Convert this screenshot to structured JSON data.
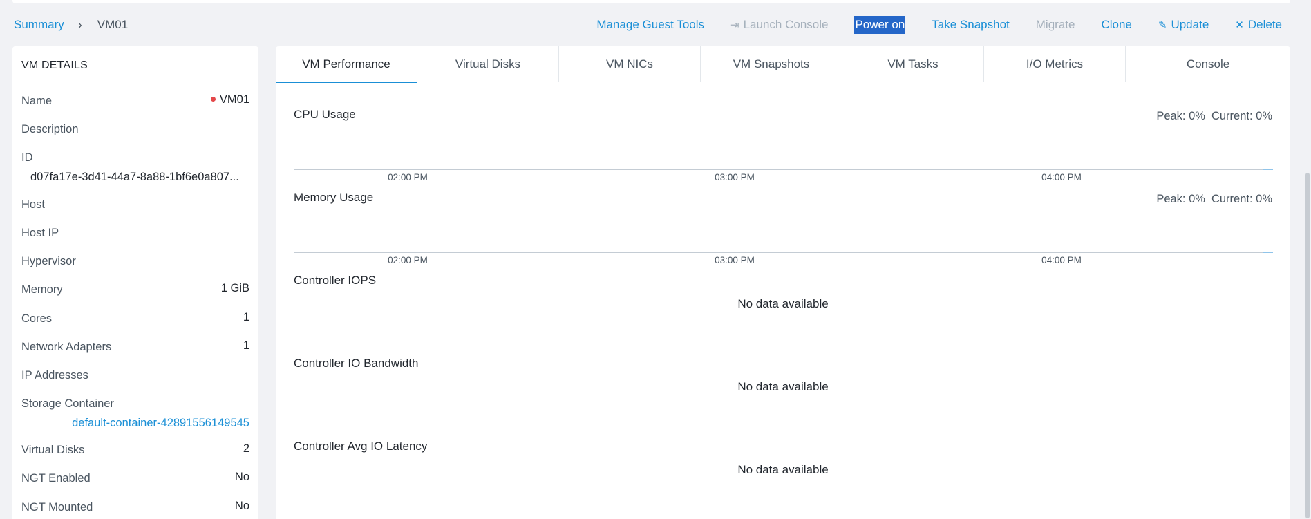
{
  "breadcrumb": {
    "root": "Summary",
    "separator": "›",
    "current": "VM01"
  },
  "actions": [
    {
      "label": "Manage Guest Tools",
      "icon": "",
      "state": "enabled"
    },
    {
      "label": "Launch Console",
      "icon": "⇥",
      "state": "disabled"
    },
    {
      "label": "Power on",
      "icon": "",
      "state": "highlighted"
    },
    {
      "label": "Take Snapshot",
      "icon": "",
      "state": "enabled"
    },
    {
      "label": "Migrate",
      "icon": "",
      "state": "disabled"
    },
    {
      "label": "Clone",
      "icon": "",
      "state": "enabled"
    },
    {
      "label": "Update",
      "icon": "✎",
      "state": "enabled"
    },
    {
      "label": "Delete",
      "icon": "✕",
      "state": "enabled"
    }
  ],
  "details": {
    "title": "VM DETAILS",
    "rows": {
      "name": {
        "label": "Name",
        "value": "VM01",
        "status_color": "#e4484a"
      },
      "description": {
        "label": "Description",
        "value": ""
      },
      "id": {
        "label": "ID",
        "value": "d07fa17e-3d41-44a7-8a88-1bf6e0a807..."
      },
      "host": {
        "label": "Host",
        "value": ""
      },
      "host_ip": {
        "label": "Host IP",
        "value": ""
      },
      "hypervisor": {
        "label": "Hypervisor",
        "value": ""
      },
      "memory": {
        "label": "Memory",
        "value": "1 GiB"
      },
      "cores": {
        "label": "Cores",
        "value": "1"
      },
      "network_adapters": {
        "label": "Network Adapters",
        "value": "1"
      },
      "ip_addresses": {
        "label": "IP Addresses",
        "value": ""
      },
      "storage_container": {
        "label": "Storage Container",
        "value": "default-container-42891556149545"
      },
      "virtual_disks": {
        "label": "Virtual Disks",
        "value": "2"
      },
      "ngt_enabled": {
        "label": "NGT Enabled",
        "value": "No"
      },
      "ngt_mounted": {
        "label": "NGT Mounted",
        "value": "No"
      }
    }
  },
  "tabs": [
    {
      "label": "VM Performance",
      "active": true
    },
    {
      "label": "Virtual Disks",
      "active": false
    },
    {
      "label": "VM NICs",
      "active": false
    },
    {
      "label": "VM Snapshots",
      "active": false
    },
    {
      "label": "VM Tasks",
      "active": false
    },
    {
      "label": "I/O Metrics",
      "active": false
    },
    {
      "label": "Console",
      "active": false
    }
  ],
  "metrics": {
    "cpu": {
      "title": "CPU Usage",
      "peak": "Peak: 0%",
      "current": "Current: 0%"
    },
    "memory": {
      "title": "Memory Usage",
      "peak": "Peak: 0%",
      "current": "Current: 0%"
    },
    "iops": {
      "title": "Controller IOPS",
      "message": "No data available"
    },
    "bandwidth": {
      "title": "Controller IO Bandwidth",
      "message": "No data available"
    },
    "latency": {
      "title": "Controller Avg IO Latency",
      "message": "No data available"
    }
  },
  "chart_data": [
    {
      "type": "line",
      "title": "CPU Usage",
      "x_ticks": [
        "02:00 PM",
        "03:00 PM",
        "04:00 PM"
      ],
      "series": [
        {
          "values": [
            0
          ]
        }
      ],
      "annotations": [
        "Peak: 0%",
        "Current: 0%"
      ]
    },
    {
      "type": "line",
      "title": "Memory Usage",
      "x_ticks": [
        "02:00 PM",
        "03:00 PM",
        "04:00 PM"
      ],
      "series": [
        {
          "values": [
            0
          ]
        }
      ],
      "annotations": [
        "Peak: 0%",
        "Current: 0%"
      ]
    }
  ],
  "colors": {
    "accent": "#1a8fd6",
    "highlight": "#2466c8",
    "status_off": "#e4484a"
  }
}
